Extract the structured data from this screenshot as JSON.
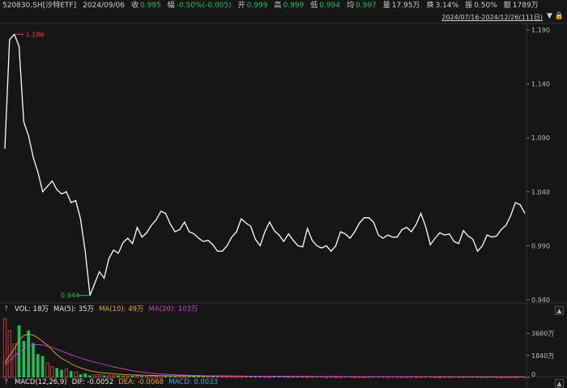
{
  "header": {
    "symbol": "520830.SH[沙特ETF]",
    "date": "2024/09/06",
    "close_label": "收",
    "close": "0.995",
    "change_label": "幅",
    "change": "-0.50%(-0.005)",
    "open_label": "开",
    "open": "0.999",
    "high_label": "高",
    "high": "0.999",
    "low_label": "低",
    "low": "0.994",
    "avg_label": "均",
    "avg": "0.997",
    "volume_label": "量",
    "volume": "17.95万",
    "turnover_label": "换",
    "turnover": "3.14%",
    "amplitude_label": "振",
    "amplitude": "0.50%",
    "amount_label": "额",
    "amount": "1789万"
  },
  "range_label": "2024/07/16-2024/12/26(111日)",
  "vol_bar": {
    "q": "?",
    "vol": "VOL: 18万",
    "ma5": "MA(5): 35万",
    "ma10": "MA(10): 49万",
    "ma20": "MA(20): 103万"
  },
  "macd_bar": {
    "q": "?",
    "macd": "MACD(12,26,9)",
    "dif": "DIF: -0.0052",
    "dea": "DEA: -0.0068",
    "macdv": "MACD: 0.0033"
  },
  "colors": {
    "up": "#e8424a",
    "down": "#17c45a",
    "line": "#ffffff",
    "ma10": "#f0a030",
    "ma20": "#d040d0",
    "macd": "#2fb0e0"
  },
  "chart_data": [
    {
      "type": "line",
      "title": "",
      "yticks": [
        "1.190",
        "1.140",
        "1.090",
        "1.040",
        "0.990",
        "0.940"
      ],
      "ylim": [
        0.94,
        1.19
      ],
      "annotations": {
        "max": "1.186",
        "min": "0.944"
      },
      "values": [
        1.08,
        1.181,
        1.186,
        1.175,
        1.105,
        1.092,
        1.072,
        1.058,
        1.04,
        1.045,
        1.05,
        1.042,
        1.038,
        1.04,
        1.03,
        1.032,
        1.015,
        0.985,
        0.944,
        0.955,
        0.966,
        0.96,
        0.978,
        0.986,
        0.983,
        0.993,
        0.997,
        0.992,
        1.007,
        0.998,
        1.002,
        1.009,
        1.014,
        1.022,
        1.02,
        1.01,
        1.003,
        1.005,
        1.012,
        1.003,
        1.001,
        0.997,
        0.994,
        0.995,
        0.991,
        0.985,
        0.985,
        0.99,
        0.998,
        1.003,
        1.015,
        1.011,
        1.008,
        0.996,
        0.99,
        1.003,
        1.012,
        1.004,
        1.0,
        0.994,
        1.001,
        0.995,
        0.99,
        0.989,
        1.006,
        0.995,
        0.99,
        0.988,
        0.99,
        0.985,
        0.99,
        1.003,
        1.001,
        0.997,
        1.003,
        1.011,
        1.016,
        1.016,
        1.012,
        1.0,
        0.997,
        1.0,
        0.998,
        0.998,
        1.005,
        1.007,
        1.003,
        1.01,
        1.02,
        1.008,
        0.991,
        0.997,
        1.002,
        1.0,
        1.001,
        0.994,
        0.992,
        1.004,
        0.999,
        0.996,
        0.985,
        0.99,
        1.0,
        0.998,
        0.999,
        1.005,
        1.009,
        1.018,
        1.03,
        1.028,
        1.02
      ]
    },
    {
      "type": "bar",
      "yticks": [
        "3680万",
        "1840万",
        "0"
      ],
      "ylim": [
        0,
        5000
      ],
      "values": [
        4900,
        3920,
        2800,
        4350,
        3050,
        3920,
        2870,
        1950,
        1800,
        1210,
        900,
        780,
        640,
        700,
        530,
        440,
        260,
        330,
        180,
        210,
        240,
        180,
        140,
        150,
        160,
        130,
        120,
        150,
        140,
        120,
        90,
        130,
        110,
        150,
        140,
        100,
        90,
        120,
        100,
        80,
        110,
        90,
        140,
        110,
        120,
        90,
        100,
        80,
        130,
        120,
        100,
        90,
        100,
        120,
        90,
        110,
        80,
        70,
        90,
        110,
        100,
        90,
        80,
        70,
        100,
        90,
        80,
        90,
        70,
        60,
        90,
        80,
        70,
        80,
        90,
        70,
        60,
        70,
        80,
        90,
        60,
        70,
        80,
        70,
        60,
        70,
        60,
        80,
        70,
        60,
        70,
        60,
        50,
        60,
        70,
        60,
        50,
        60,
        50,
        60,
        50,
        60,
        50,
        60,
        50,
        60,
        50,
        60,
        50,
        60,
        40
      ],
      "series": [
        {
          "name": "MA(10)",
          "values": [
            1200,
            1800,
            2400,
            3100,
            3500,
            3600,
            3540,
            3300,
            3000,
            2700,
            2300,
            1900,
            1600,
            1380,
            1150,
            950,
            800,
            680,
            560,
            480,
            420,
            380,
            340,
            300,
            270,
            250,
            230,
            210,
            200,
            190,
            180,
            170,
            160,
            150,
            148,
            145,
            140,
            136,
            130,
            128,
            125,
            120,
            120,
            118,
            115,
            112,
            110,
            108,
            105,
            102,
            100,
            98,
            96,
            95,
            94,
            92,
            90,
            88,
            86,
            85,
            84,
            82,
            80,
            80,
            79,
            78,
            77,
            76,
            75,
            74,
            73,
            72,
            71,
            70,
            70,
            69,
            68,
            67,
            66,
            66,
            65,
            64,
            63,
            62,
            62,
            61,
            60,
            60,
            59,
            58,
            58,
            57,
            56,
            56,
            55,
            55,
            54,
            54,
            53,
            53,
            52,
            52,
            51,
            51,
            50,
            50,
            49,
            49,
            48,
            48,
            48
          ]
        },
        {
          "name": "MA(20)",
          "values": [
            1000,
            1400,
            1800,
            2100,
            2400,
            2600,
            2700,
            2750,
            2700,
            2600,
            2500,
            2350,
            2200,
            2050,
            1900,
            1760,
            1620,
            1500,
            1380,
            1280,
            1180,
            1080,
            980,
            880,
            800,
            720,
            640,
            560,
            500,
            450,
            400,
            360,
            320,
            290,
            270,
            250,
            230,
            210,
            195,
            180,
            170,
            160,
            152,
            145,
            140,
            135,
            130,
            125,
            120,
            117,
            114,
            111,
            108,
            105,
            103,
            101,
            99,
            97,
            95,
            93,
            91,
            89,
            87,
            85,
            84,
            83,
            82,
            81,
            80,
            79,
            78,
            77,
            76,
            75,
            74,
            73,
            72,
            71,
            70,
            69,
            68,
            67,
            66,
            65,
            64,
            63,
            62,
            62,
            61,
            60,
            60,
            59,
            59,
            58,
            58,
            57,
            57,
            56,
            56,
            55,
            55,
            54,
            54,
            53,
            53,
            52,
            52,
            52,
            51,
            51,
            50
          ]
        }
      ]
    }
  ]
}
